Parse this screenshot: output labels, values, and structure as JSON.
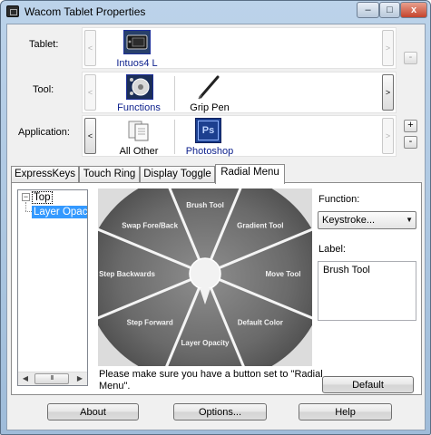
{
  "window": {
    "title": "Wacom Tablet Properties",
    "minimize_glyph": "–",
    "maximize_glyph": "□",
    "close_glyph": "x"
  },
  "rows": {
    "tablet": {
      "label": "Tablet:",
      "items": [
        {
          "label": "Intuos4 L",
          "icon": "tablet-icon",
          "selected": true
        }
      ],
      "side_buttons": [
        "-"
      ]
    },
    "tool": {
      "label": "Tool:",
      "items": [
        {
          "label": "Functions",
          "icon": "functions-icon",
          "selected": true
        },
        {
          "label": "Grip Pen",
          "icon": "pen-icon",
          "selected": false
        }
      ]
    },
    "application": {
      "label": "Application:",
      "items": [
        {
          "label": "All Other",
          "icon": "all-other-icon",
          "selected": false
        },
        {
          "label": "Photoshop",
          "icon": "photoshop-icon",
          "badge": "Ps",
          "selected": true
        }
      ],
      "side_buttons": [
        "+",
        "-"
      ]
    }
  },
  "arrows": {
    "left": "<",
    "right": ">"
  },
  "tabs": [
    {
      "label": "ExpressKeys",
      "active": false
    },
    {
      "label": "Touch Ring",
      "active": false
    },
    {
      "label": "Display Toggle",
      "active": false
    },
    {
      "label": "Radial Menu",
      "active": true
    }
  ],
  "tree": {
    "expander": "−",
    "root": "Top",
    "child": "Layer Opacity",
    "scroll_left": "◀",
    "scroll_thumb": "III",
    "scroll_right": "▶"
  },
  "radial_menu": {
    "items": [
      "Brush Tool",
      "Gradient Tool",
      "Move Tool",
      "Default Color",
      "Layer Opacity",
      "Step Forward",
      "Step Backwards",
      "Swap Fore/Back"
    ],
    "message": "Please make sure you have a button set to \"Radial Menu\"."
  },
  "function": {
    "label": "Function:",
    "value": "Keystroke...",
    "dropdown_glyph": "▼"
  },
  "label_field": {
    "label": "Label:",
    "value": "Brush Tool"
  },
  "buttons": {
    "default": "Default",
    "about": "About",
    "options": "Options...",
    "help": "Help"
  },
  "colors": {
    "title_gradient_top": "#bcd3ea",
    "selection": "#3399ff",
    "selected_text": "#0b1f8c",
    "photoshop_blue": "#1c3f8f",
    "close_red": "#c5442c"
  }
}
